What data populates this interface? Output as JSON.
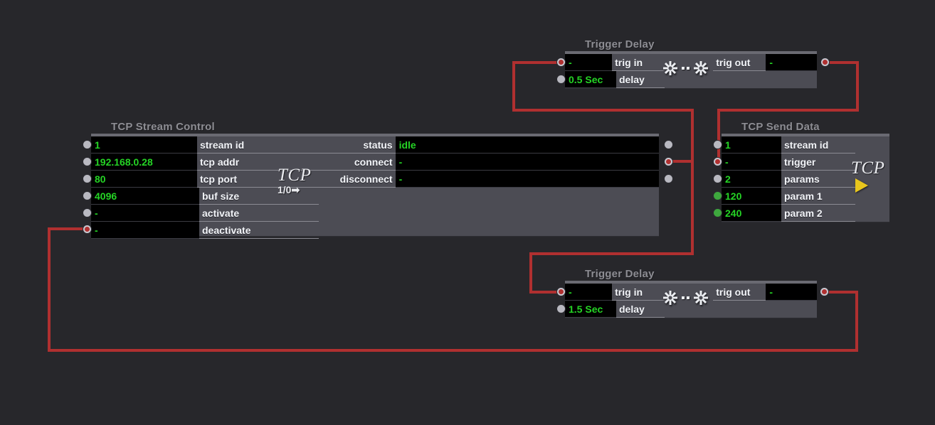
{
  "canvas": {
    "background": "#27272b",
    "node_body": "#4c4c54",
    "wire_color": "#b03030",
    "value_color": "#25d425",
    "label_color": "#f2f4f8",
    "title_color": "#8d8d93"
  },
  "nodes": {
    "tcp_stream_control": {
      "title": "TCP Stream Control",
      "badge_word": "TCP",
      "badge_io": "1/0",
      "inputs": [
        {
          "label": "stream id",
          "value": "1"
        },
        {
          "label": "tcp addr",
          "value": "192.168.0.28"
        },
        {
          "label": "tcp port",
          "value": "80"
        },
        {
          "label": "buf size",
          "value": "4096"
        },
        {
          "label": "activate",
          "value": "-"
        },
        {
          "label": "deactivate",
          "value": "-"
        }
      ],
      "outputs": [
        {
          "label": "status",
          "value": "idle"
        },
        {
          "label": "connect",
          "value": "-"
        },
        {
          "label": "disconnect",
          "value": "-"
        }
      ]
    },
    "trigger_delay_top": {
      "title": "Trigger Delay",
      "in_label": "trig in",
      "in_value": "-",
      "delay_label": "delay",
      "delay_value": "0.5 Sec",
      "out_label": "trig out",
      "out_value": "-"
    },
    "trigger_delay_bottom": {
      "title": "Trigger Delay",
      "in_label": "trig in",
      "in_value": "-",
      "delay_label": "delay",
      "delay_value": "1.5 Sec",
      "out_label": "trig out",
      "out_value": "-"
    },
    "tcp_send_data": {
      "title": "TCP Send Data",
      "badge_word": "TCP",
      "rows": [
        {
          "label": "stream id",
          "value": "1"
        },
        {
          "label": "trigger",
          "value": "-"
        },
        {
          "label": "params",
          "value": "2"
        },
        {
          "label": "param 1",
          "value": "120"
        },
        {
          "label": "param 2",
          "value": "240"
        }
      ]
    }
  }
}
